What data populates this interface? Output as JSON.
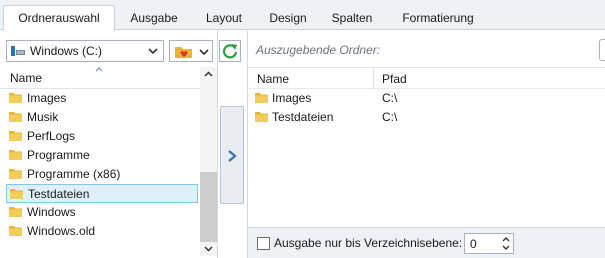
{
  "tabs": [
    {
      "label": "Ordnerauswahl",
      "active": true
    },
    {
      "label": "Ausgabe",
      "active": false
    },
    {
      "label": "Layout",
      "active": false
    },
    {
      "label": "Design",
      "active": false
    },
    {
      "label": "Spalten",
      "active": false
    },
    {
      "label": "Formatierung",
      "active": false
    }
  ],
  "left": {
    "drive_select": "Windows (C:)",
    "column_header": "Name",
    "folders": [
      "Images",
      "Musik",
      "PerfLogs",
      "Programme",
      "Programme (x86)",
      "Testdateien",
      "Windows",
      "Windows.old"
    ],
    "selected_folder": "Testdateien"
  },
  "right": {
    "output_label": "Auszugebende Ordner:",
    "col_name": "Name",
    "col_path": "Pfad",
    "rows": [
      {
        "name": "Images",
        "path": "C:\\"
      },
      {
        "name": "Testdateien",
        "path": "C:\\"
      }
    ],
    "depth_checkbox_label": "Ausgabe nur bis Verzeichnisebene:",
    "depth_checked": false,
    "depth_value": "0"
  },
  "colors": {
    "folder": "#e8b431",
    "selection_bg": "#dff0fb",
    "selection_border": "#84c5ea",
    "refresh_green": "#2e9d3e",
    "arrow_blue": "#3a6fb0"
  }
}
